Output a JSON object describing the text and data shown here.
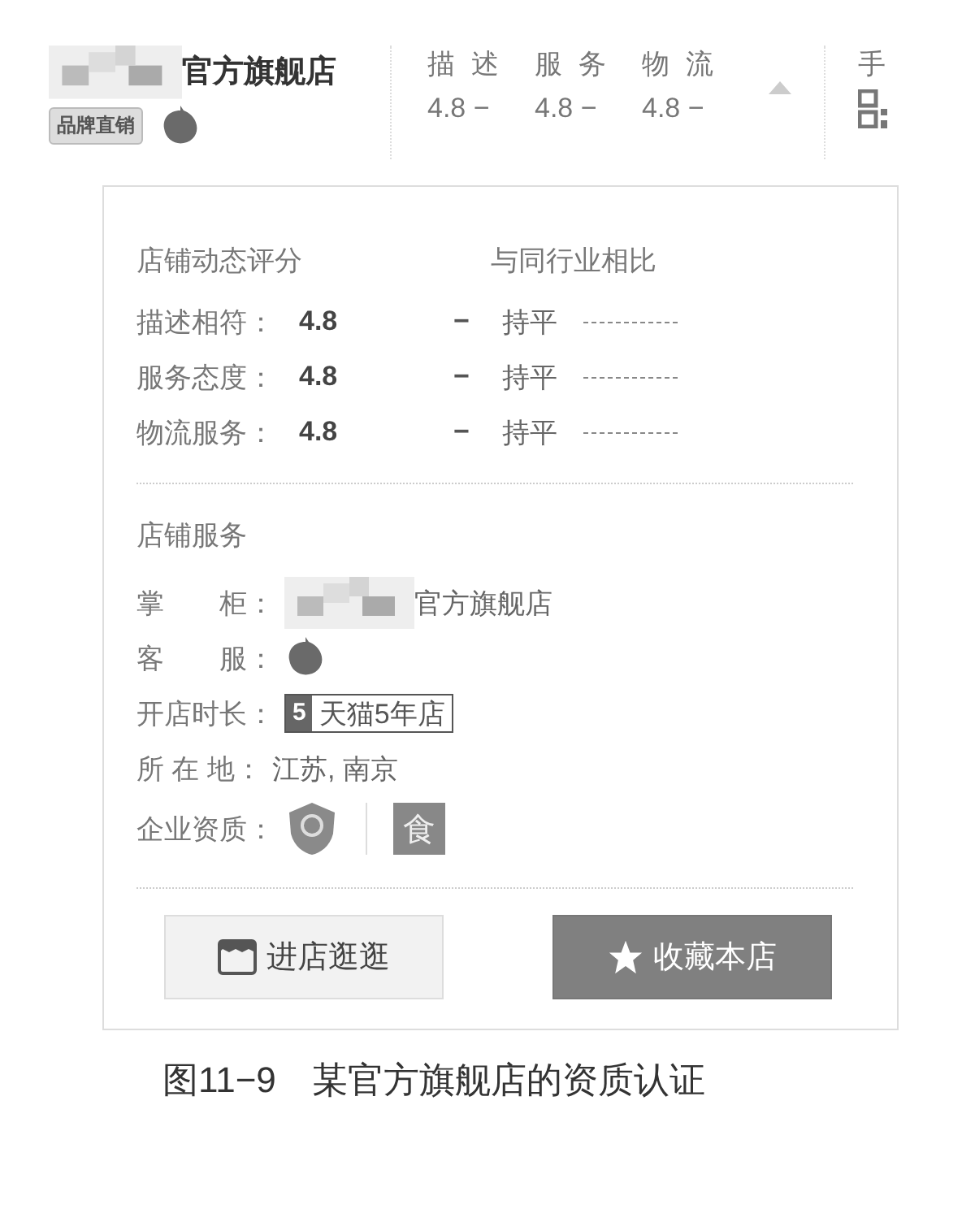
{
  "header": {
    "store_name": "官方旗舰店",
    "tag": "品牌直销",
    "scores": [
      {
        "label": "描述",
        "value": "4.8",
        "trend": "−"
      },
      {
        "label": "服务",
        "value": "4.8",
        "trend": "−"
      },
      {
        "label": "物流",
        "value": "4.8",
        "trend": "−"
      }
    ],
    "mobile_label": "手"
  },
  "popup": {
    "ratings_title": "店铺动态评分",
    "compare_title": "与同行业相比",
    "ratings": [
      {
        "label": "描述相符：",
        "value": "4.8",
        "trend": "−",
        "compare": "持平"
      },
      {
        "label": "服务态度：",
        "value": "4.8",
        "trend": "−",
        "compare": "持平"
      },
      {
        "label": "物流服务：",
        "value": "4.8",
        "trend": "−",
        "compare": "持平"
      }
    ],
    "services_title": "店铺服务",
    "services": [
      {
        "kind": "owner",
        "label": "掌　　柜：",
        "value": "官方旗舰店"
      },
      {
        "kind": "chat",
        "label": "客　　服："
      },
      {
        "kind": "badge",
        "label": "开店时长：",
        "badge_number": "5",
        "value": "天猫5年店"
      },
      {
        "kind": "text",
        "label": "所 在 地：",
        "value": "江苏, 南京"
      },
      {
        "kind": "licenses",
        "label": "企业资质：",
        "license_text": "食"
      }
    ],
    "buttons": [
      {
        "label": "进店逛逛",
        "primary": false
      },
      {
        "label": "收藏本店",
        "primary": true
      }
    ]
  },
  "caption": "图11−9　某官方旗舰店的资质认证"
}
